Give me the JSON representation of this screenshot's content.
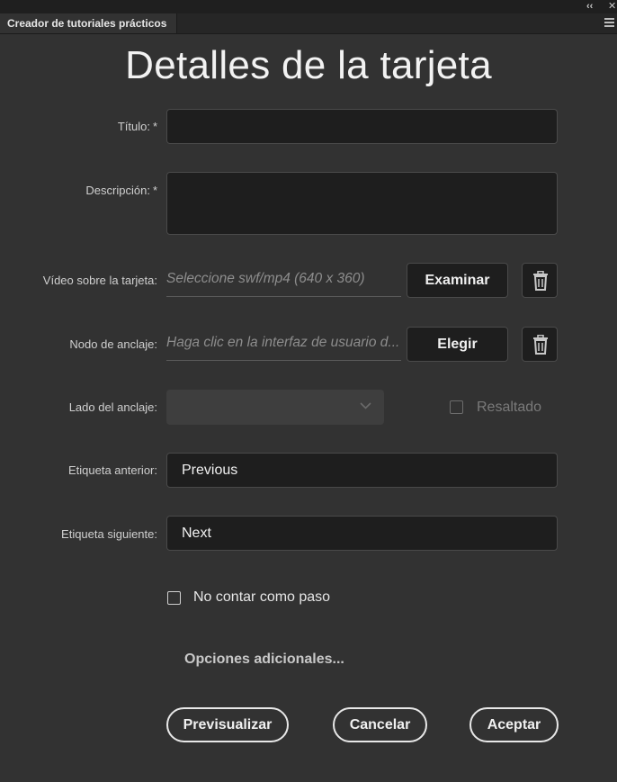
{
  "panel": {
    "tab_label": "Creador de tutoriales prácticos",
    "collapse_glyph": "‹‹",
    "close_glyph": "✕",
    "menu_icon": "hamburger-menu-icon"
  },
  "title": "Detalles de la tarjeta",
  "form": {
    "title_label": "Título:",
    "title_value": "",
    "description_label": "Descripción:",
    "description_value": "",
    "required_mark": "*",
    "video_label": "Vídeo sobre la tarjeta:",
    "video_placeholder": "Seleccione swf/mp4 (640 x 360)",
    "browse_button": "Examinar",
    "anchor_node_label": "Nodo de anclaje:",
    "anchor_node_placeholder": "Haga clic en la interfaz de usuario d...",
    "choose_button": "Elegir",
    "anchor_side_label": "Lado del anclaje:",
    "anchor_side_value": "",
    "highlight_label": "Resaltado",
    "prev_label": "Etiqueta anterior:",
    "prev_value": "Previous",
    "next_label": "Etiqueta siguiente:",
    "next_value": "Next",
    "not_step_label": "No contar como paso",
    "more_options": "Opciones adicionales..."
  },
  "buttons": {
    "preview": "Previsualizar",
    "cancel": "Cancelar",
    "accept": "Aceptar"
  },
  "colors": {
    "background": "#323232",
    "field": "#1e1e1e",
    "text": "#f0f0f0"
  }
}
